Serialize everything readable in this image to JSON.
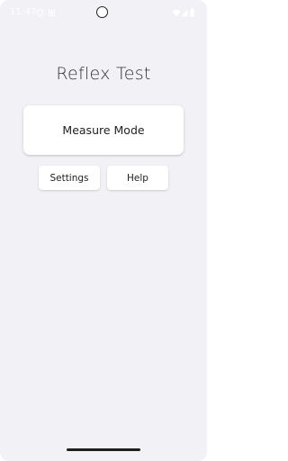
{
  "status_bar": {
    "time": "11:47",
    "icons": [
      "shield-icon",
      "sim-icon",
      "wifi-icon",
      "signal-icon",
      "battery-icon"
    ]
  },
  "app": {
    "title": "Reflex Test"
  },
  "buttons": {
    "measure_mode": "Measure Mode",
    "settings": "Settings",
    "help": "Help"
  },
  "colors": {
    "background": "#f2f1f6",
    "button_background": "#ffffff",
    "text": "#333333",
    "status_bar_text": "#ffffff"
  }
}
